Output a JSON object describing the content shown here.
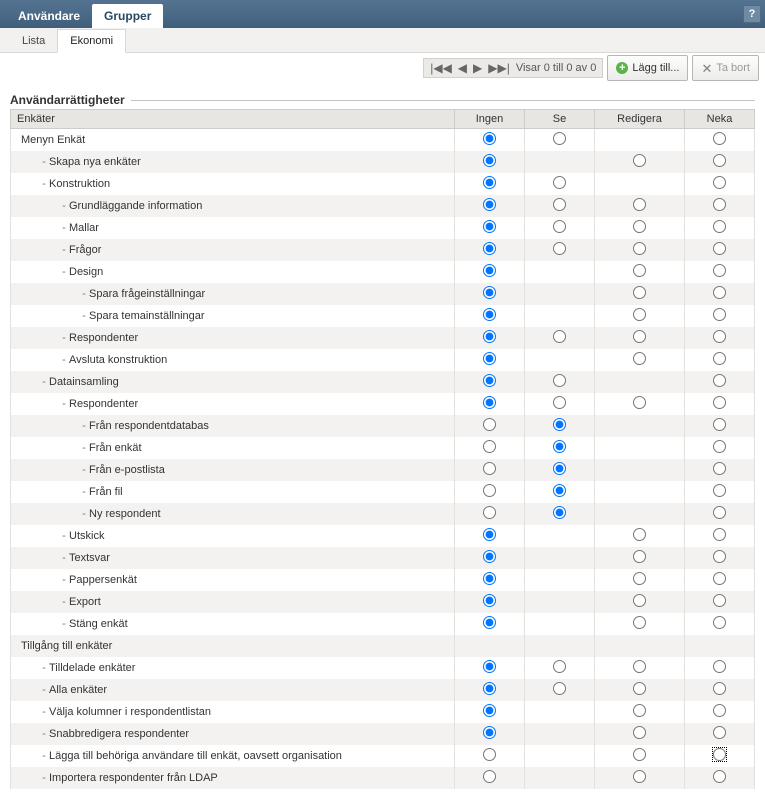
{
  "topTabs": {
    "users": "Användare",
    "groups": "Grupper"
  },
  "subTabs": {
    "list": "Lista",
    "economy": "Ekonomi"
  },
  "pager": {
    "text": "Visar 0 till 0 av 0"
  },
  "buttons": {
    "add": "Lägg till...",
    "remove": "Ta bort"
  },
  "section": {
    "title": "Användarrättigheter"
  },
  "columns": {
    "name": "Enkäter",
    "none": "Ingen",
    "see": "Se",
    "edit": "Redigera",
    "deny": "Neka"
  },
  "rows": [
    {
      "label": "Menyn Enkät",
      "indent": 0,
      "dash": false,
      "ingen": "checked",
      "se": "unchecked",
      "red": null,
      "neka": "unchecked"
    },
    {
      "label": "Skapa nya enkäter",
      "indent": 1,
      "dash": true,
      "ingen": "checked",
      "se": null,
      "red": "unchecked",
      "neka": "unchecked"
    },
    {
      "label": "Konstruktion",
      "indent": 1,
      "dash": true,
      "ingen": "checked",
      "se": "unchecked",
      "red": null,
      "neka": "unchecked"
    },
    {
      "label": "Grundläggande information",
      "indent": 2,
      "dash": true,
      "ingen": "checked",
      "se": "unchecked",
      "red": "unchecked",
      "neka": "unchecked"
    },
    {
      "label": "Mallar",
      "indent": 2,
      "dash": true,
      "ingen": "checked",
      "se": "unchecked",
      "red": "unchecked",
      "neka": "unchecked"
    },
    {
      "label": "Frågor",
      "indent": 2,
      "dash": true,
      "ingen": "checked",
      "se": "unchecked",
      "red": "unchecked",
      "neka": "unchecked"
    },
    {
      "label": "Design",
      "indent": 2,
      "dash": true,
      "ingen": "checked",
      "se": null,
      "red": "unchecked",
      "neka": "unchecked"
    },
    {
      "label": "Spara frågeinställningar",
      "indent": 3,
      "dash": true,
      "ingen": "checked",
      "se": null,
      "red": "unchecked",
      "neka": "unchecked"
    },
    {
      "label": "Spara temainställningar",
      "indent": 3,
      "dash": true,
      "ingen": "checked",
      "se": null,
      "red": "unchecked",
      "neka": "unchecked"
    },
    {
      "label": "Respondenter",
      "indent": 2,
      "dash": true,
      "ingen": "checked",
      "se": "unchecked",
      "red": "unchecked",
      "neka": "unchecked"
    },
    {
      "label": "Avsluta konstruktion",
      "indent": 2,
      "dash": true,
      "ingen": "checked",
      "se": null,
      "red": "unchecked",
      "neka": "unchecked"
    },
    {
      "label": "Datainsamling",
      "indent": 1,
      "dash": true,
      "ingen": "checked",
      "se": "unchecked",
      "red": null,
      "neka": "unchecked"
    },
    {
      "label": "Respondenter",
      "indent": 2,
      "dash": true,
      "ingen": "checked",
      "se": "unchecked",
      "red": "unchecked",
      "neka": "unchecked"
    },
    {
      "label": "Från respondentdatabas",
      "indent": 3,
      "dash": true,
      "ingen": "unchecked",
      "se": "checked",
      "red": null,
      "neka": "unchecked"
    },
    {
      "label": "Från enkät",
      "indent": 3,
      "dash": true,
      "ingen": "unchecked",
      "se": "checked",
      "red": null,
      "neka": "unchecked"
    },
    {
      "label": "Från e-postlista",
      "indent": 3,
      "dash": true,
      "ingen": "unchecked",
      "se": "checked",
      "red": null,
      "neka": "unchecked"
    },
    {
      "label": "Från fil",
      "indent": 3,
      "dash": true,
      "ingen": "unchecked",
      "se": "checked",
      "red": null,
      "neka": "unchecked"
    },
    {
      "label": "Ny respondent",
      "indent": 3,
      "dash": true,
      "ingen": "unchecked",
      "se": "checked",
      "red": null,
      "neka": "unchecked"
    },
    {
      "label": "Utskick",
      "indent": 2,
      "dash": true,
      "ingen": "checked",
      "se": null,
      "red": "unchecked",
      "neka": "unchecked"
    },
    {
      "label": "Textsvar",
      "indent": 2,
      "dash": true,
      "ingen": "checked",
      "se": null,
      "red": "unchecked",
      "neka": "unchecked"
    },
    {
      "label": "Pappersenkät",
      "indent": 2,
      "dash": true,
      "ingen": "checked",
      "se": null,
      "red": "unchecked",
      "neka": "unchecked"
    },
    {
      "label": "Export",
      "indent": 2,
      "dash": true,
      "ingen": "checked",
      "se": null,
      "red": "unchecked",
      "neka": "unchecked"
    },
    {
      "label": "Stäng enkät",
      "indent": 2,
      "dash": true,
      "ingen": "checked",
      "se": null,
      "red": "unchecked",
      "neka": "unchecked"
    },
    {
      "label": "Tillgång till enkäter",
      "indent": 0,
      "dash": false,
      "ingen": null,
      "se": null,
      "red": null,
      "neka": null
    },
    {
      "label": "Tilldelade enkäter",
      "indent": 1,
      "dash": true,
      "ingen": "checked",
      "se": "unchecked",
      "red": "unchecked",
      "neka": "unchecked"
    },
    {
      "label": "Alla enkäter",
      "indent": 1,
      "dash": true,
      "ingen": "checked",
      "se": "unchecked",
      "red": "unchecked",
      "neka": "unchecked"
    },
    {
      "label": "Välja kolumner i respondentlistan",
      "indent": 1,
      "dash": true,
      "ingen": "checked",
      "se": null,
      "red": "unchecked",
      "neka": "unchecked"
    },
    {
      "label": "Snabbredigera respondenter",
      "indent": 1,
      "dash": true,
      "ingen": "checked",
      "se": null,
      "red": "unchecked",
      "neka": "unchecked"
    },
    {
      "label": "Lägga till behöriga användare till enkät, oavsett organisation",
      "indent": 1,
      "dash": true,
      "ingen": "unchecked",
      "se": null,
      "red": "unchecked",
      "neka": "focused"
    },
    {
      "label": "Importera respondenter från LDAP",
      "indent": 1,
      "dash": true,
      "ingen": "unchecked",
      "se": null,
      "red": "unchecked",
      "neka": "unchecked"
    }
  ]
}
